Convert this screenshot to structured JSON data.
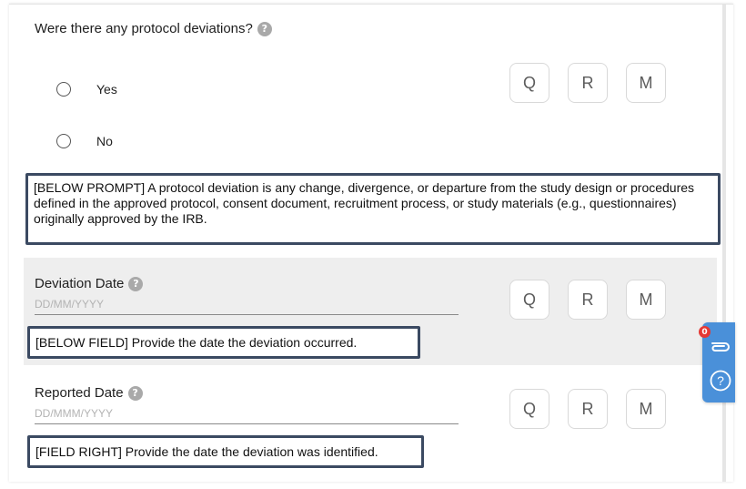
{
  "question": {
    "label": "Were there any protocol deviations?",
    "help": "?",
    "options": [
      {
        "label": "Yes"
      },
      {
        "label": "No"
      }
    ],
    "below_prompt": "[BELOW PROMPT] A protocol deviation is any change, divergence, or departure from the study design or procedures defined in the approved protocol, consent document, recruitment process, or study materials (e.g., questionnaires) originally approved by the IRB."
  },
  "qrm": {
    "q": "Q",
    "r": "R",
    "m": "M"
  },
  "deviation_date": {
    "label": "Deviation Date",
    "help": "?",
    "placeholder": "DD/MM/YYYY",
    "value": "",
    "note": "[BELOW FIELD] Provide the date the deviation occurred."
  },
  "reported_date": {
    "label": "Reported Date",
    "help": "?",
    "placeholder": "DD/MMM/YYYY",
    "value": "",
    "note": "[FIELD RIGHT] Provide the date the deviation was identified."
  },
  "side_panel": {
    "badge_count": "0",
    "icons": [
      "paperclip-icon",
      "help-circle-icon"
    ],
    "accent": "#4a90d9"
  }
}
